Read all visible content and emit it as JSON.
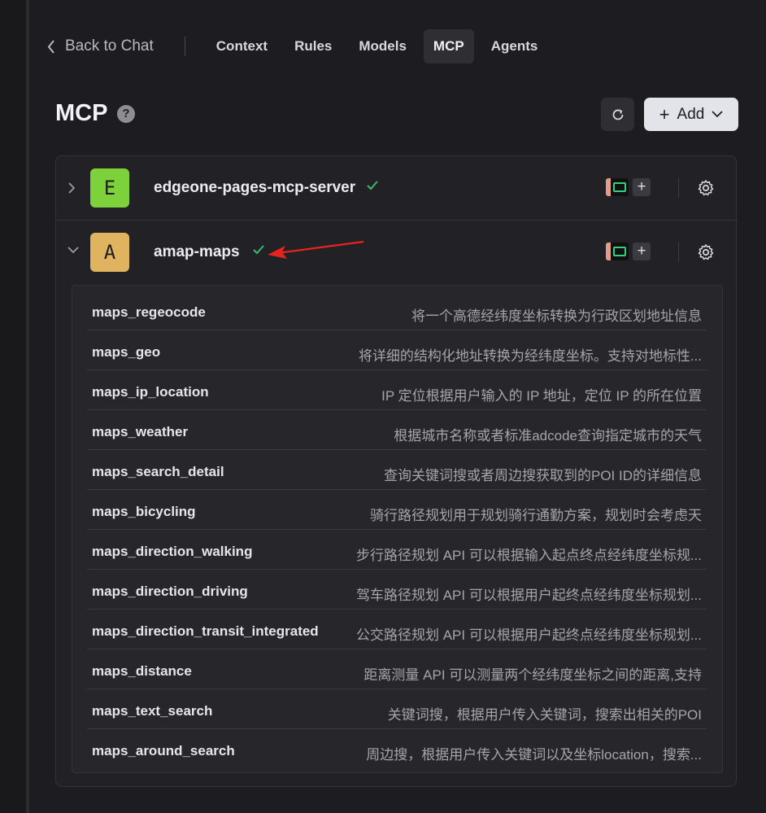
{
  "nav": {
    "back_label": "Back to Chat",
    "tabs": [
      {
        "label": "Context",
        "active": false
      },
      {
        "label": "Rules",
        "active": false
      },
      {
        "label": "Models",
        "active": false
      },
      {
        "label": "MCP",
        "active": true
      },
      {
        "label": "Agents",
        "active": false
      }
    ]
  },
  "header": {
    "title": "MCP",
    "help_glyph": "?",
    "refresh_icon": "refresh-icon",
    "add_label": "Add",
    "add_plus": "+"
  },
  "servers": [
    {
      "name": "edgeone-pages-mcp-server",
      "letter": "E",
      "color": "#7dd13a",
      "expanded": false,
      "connected": true
    },
    {
      "name": "amap-maps",
      "letter": "A",
      "color": "#dfb35f",
      "expanded": true,
      "connected": true
    }
  ],
  "tools": [
    {
      "name": "maps_regeocode",
      "desc": "将一个高德经纬度坐标转换为行政区划地址信息"
    },
    {
      "name": "maps_geo",
      "desc": "将详细的结构化地址转换为经纬度坐标。支持对地标性..."
    },
    {
      "name": "maps_ip_location",
      "desc": "IP 定位根据用户输入的 IP 地址，定位 IP 的所在位置"
    },
    {
      "name": "maps_weather",
      "desc": "根据城市名称或者标准adcode查询指定城市的天气"
    },
    {
      "name": "maps_search_detail",
      "desc": "查询关键词搜或者周边搜获取到的POI ID的详细信息"
    },
    {
      "name": "maps_bicycling",
      "desc": "骑行路径规划用于规划骑行通勤方案，规划时会考虑天"
    },
    {
      "name": "maps_direction_walking",
      "desc": "步行路径规划 API 可以根据输入起点终点经纬度坐标规..."
    },
    {
      "name": "maps_direction_driving",
      "desc": "驾车路径规划 API 可以根据用户起终点经纬度坐标规划..."
    },
    {
      "name": "maps_direction_transit_integrated",
      "desc": "公交路径规划 API 可以根据用户起终点经纬度坐标规划..."
    },
    {
      "name": "maps_distance",
      "desc": "距离测量 API 可以测量两个经纬度坐标之间的距离,支持"
    },
    {
      "name": "maps_text_search",
      "desc": "关键词搜，根据用户传入关键词，搜索出相关的POI"
    },
    {
      "name": "maps_around_search",
      "desc": "周边搜，根据用户传入关键词以及坐标location，搜索..."
    }
  ],
  "colors": {
    "connected": "#3fb96a",
    "annotation_arrow": "#e8231f"
  }
}
